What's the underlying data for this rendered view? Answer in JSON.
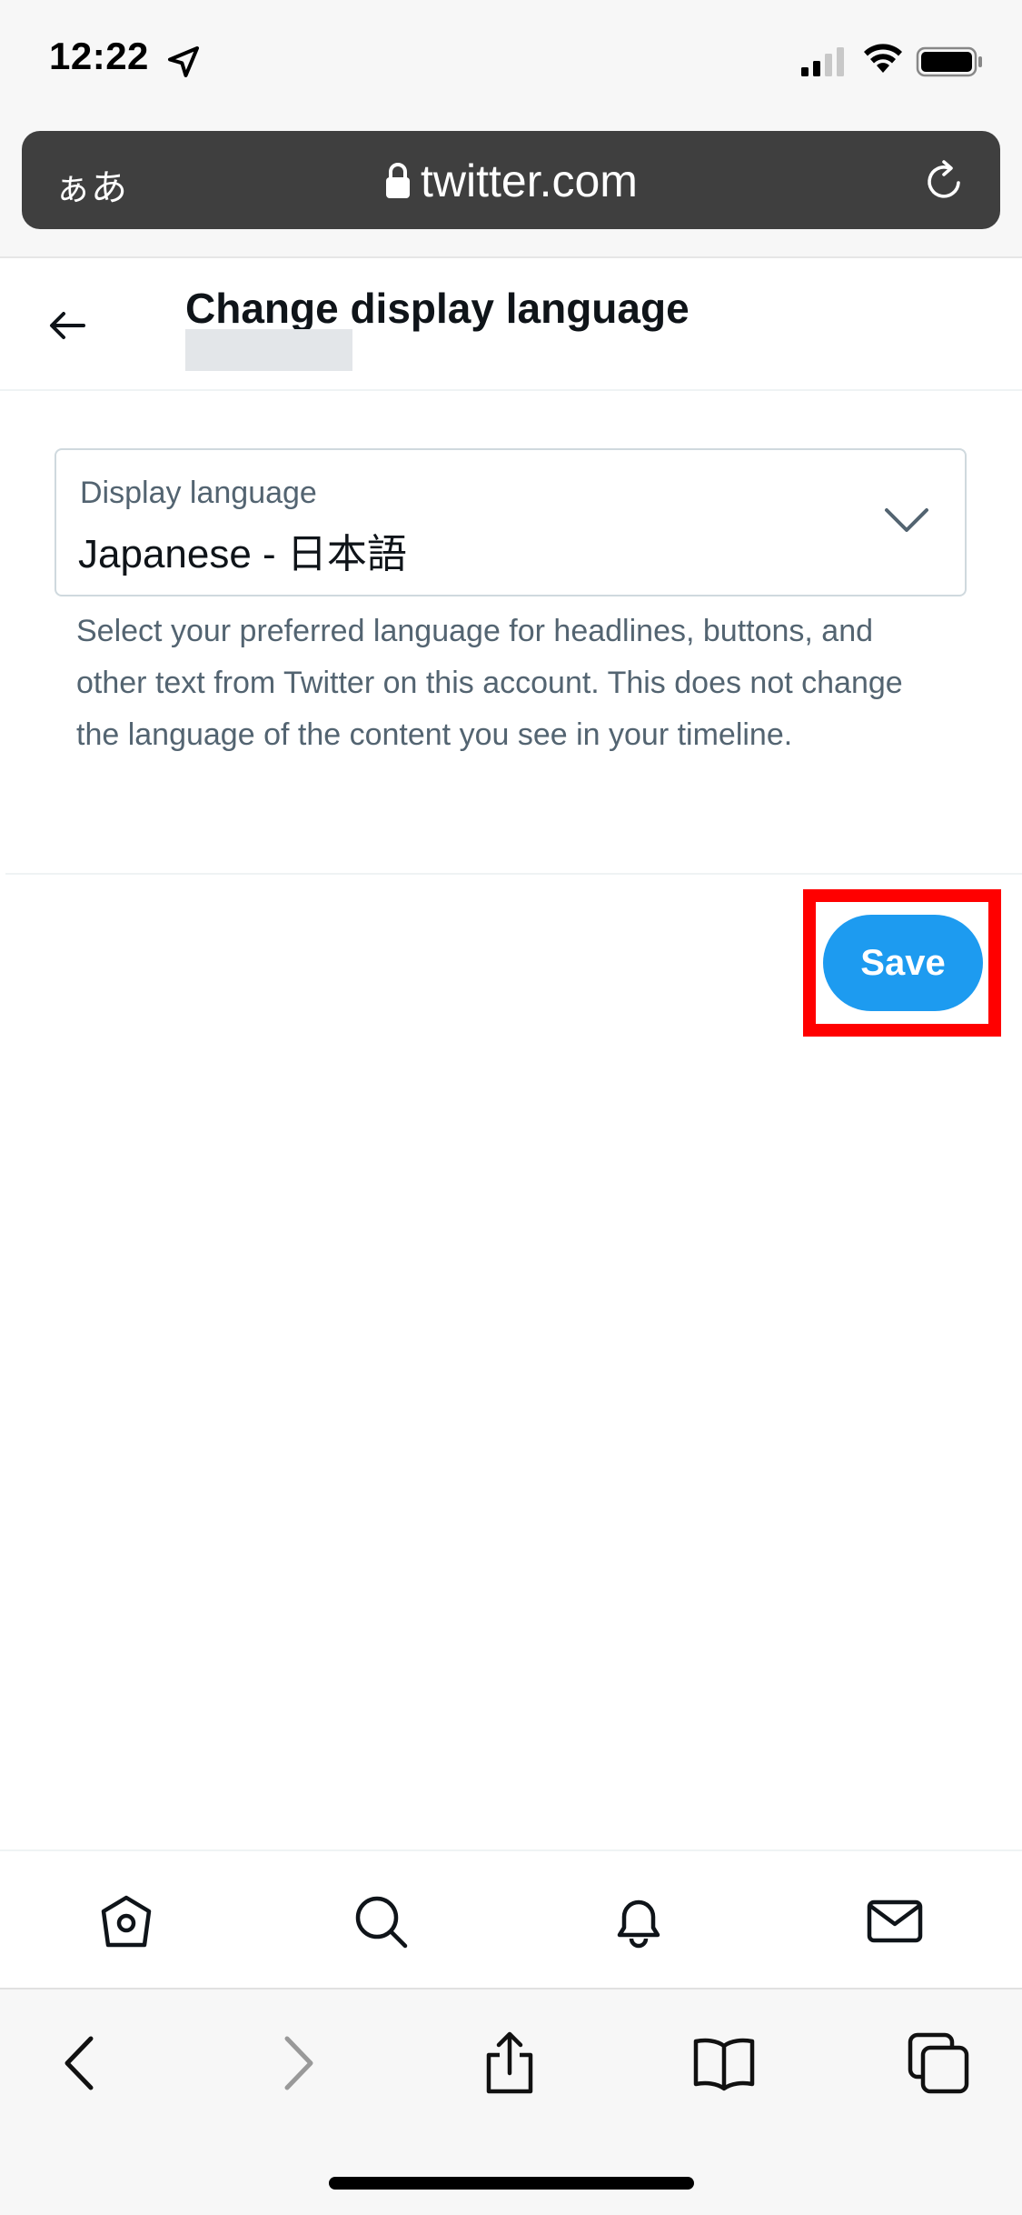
{
  "status_bar": {
    "time": "12:22"
  },
  "browser": {
    "aa_label": "ぁあ",
    "url": "twitter.com"
  },
  "header": {
    "title": "Change display language"
  },
  "language_select": {
    "label": "Display language",
    "value": "Japanese - 日本語"
  },
  "help_text": "Select your preferred language for headlines, buttons, and other text from Twitter on this account. This does not change the language of the content you see in your timeline.",
  "save_label": "Save",
  "colors": {
    "accent": "#1d9bf0",
    "highlight": "#ff0000",
    "url_bar": "#3f3f3f"
  },
  "bottom_nav": {
    "icons": [
      "home-icon",
      "search-icon",
      "notifications-icon",
      "messages-icon"
    ]
  },
  "safari_toolbar": {
    "icons": [
      "back-icon",
      "forward-icon",
      "share-icon",
      "bookmarks-icon",
      "tabs-icon"
    ]
  }
}
